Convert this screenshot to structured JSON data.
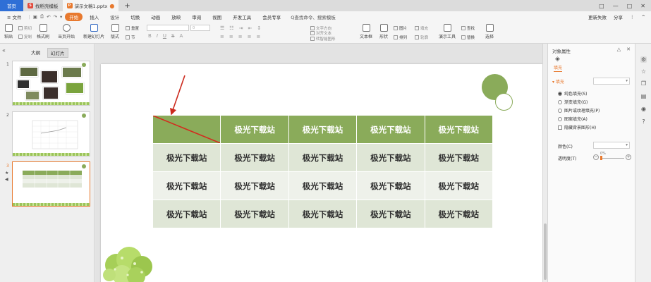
{
  "tabbar": {
    "home": "首页",
    "tabs": [
      {
        "label": "找稻壳模板",
        "logo": "S",
        "color": "#e34a3b"
      },
      {
        "label": "演示文稿1.pptx",
        "logo": "P",
        "color": "#e8792e"
      }
    ],
    "plus": "+",
    "window_icons": [
      "□",
      "—",
      "□",
      "✕"
    ]
  },
  "menubar": {
    "file": "≡ 文件",
    "items": [
      "开始",
      "插入",
      "设计",
      "切换",
      "动画",
      "放映",
      "审阅",
      "视图",
      "开发工具",
      "会员专享"
    ],
    "active": "开始",
    "search": "Q查找命令、搜索模板",
    "right": [
      "更新失败",
      "分享",
      "⋮",
      "^"
    ]
  },
  "ribbon": {
    "paste": "粘贴",
    "cut": "剪切",
    "copy": "复制",
    "format_brush": "格式刷",
    "from_start": "当页开始",
    "new_slide": "新建幻灯片",
    "layout": "版式",
    "section": "节",
    "reset": "重置",
    "font_name": "",
    "font_size": "0",
    "textbox": "文本框",
    "shape": "形状",
    "arrange": "排列",
    "picture": "图片",
    "fill": "填充",
    "outline": "轮廓",
    "demo_tools": "演示工具",
    "find": "查找",
    "replace": "替换",
    "select": "选择",
    "text_direction": "文字方向",
    "align_text": "对齐文本",
    "smart_graphic": "转智能图形"
  },
  "leftpane": {
    "tabs": [
      "大纲",
      "幻灯片"
    ],
    "active_tab": "幻灯片",
    "slides": [
      "1",
      "2",
      "3"
    ],
    "active_slide": "3"
  },
  "slide": {
    "table": {
      "cell_text": "极光下载站",
      "rows": [
        [
          "",
          "极光下载站",
          "极光下载站",
          "极光下载站",
          "极光下载站"
        ],
        [
          "极光下载站",
          "极光下载站",
          "极光下载站",
          "极光下载站",
          "极光下载站"
        ],
        [
          "极光下载站",
          "极光下载站",
          "极光下载站",
          "极光下载站",
          "极光下载站"
        ],
        [
          "极光下载站",
          "极光下载站",
          "极光下载站",
          "极光下载站",
          "极光下载站"
        ]
      ]
    },
    "colors": {
      "header": "#8aab5a",
      "band1": "#dfe6d6",
      "band2": "#eef1ea",
      "diagonal": "#d42a1e",
      "arrow": "#cc2a1e"
    }
  },
  "rightpane": {
    "title": "对象属性",
    "tab": "填充",
    "section": "填充",
    "options": [
      "纯色填充(S)",
      "渐变填充(G)",
      "图片或纹理填充(P)",
      "图案填充(A)"
    ],
    "selected_option": "纯色填充(S)",
    "hide_bg": "隐藏背景图形(H)",
    "color_label": "颜色(C)",
    "transparency_label": "透明度(T)",
    "transparency_value": "0%"
  }
}
